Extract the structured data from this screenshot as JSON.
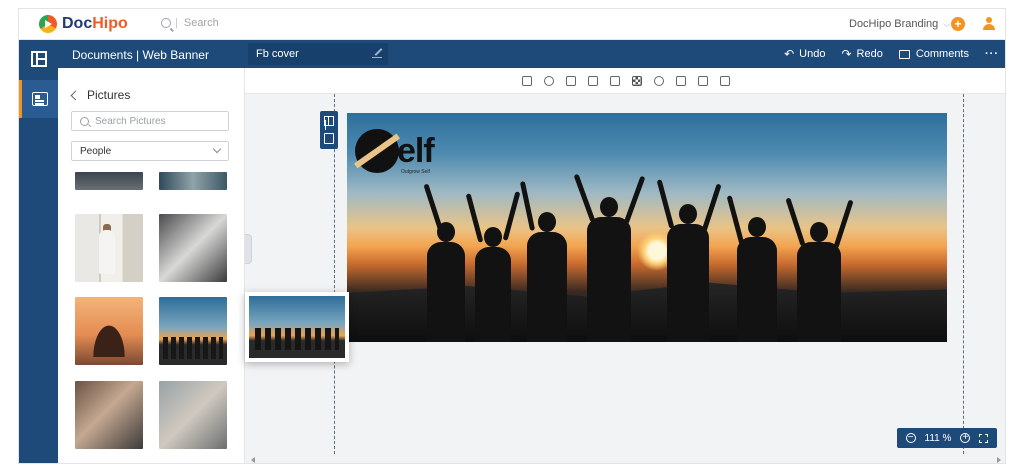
{
  "app": {
    "logo_prefix": "Doc",
    "logo_suffix": "Hipo"
  },
  "top": {
    "search_placeholder": "Search",
    "brand_menu": "DocHipo Branding"
  },
  "docbar": {
    "breadcrumb": "Documents | Web Banner",
    "doc_name": "Fb cover",
    "undo": "Undo",
    "redo": "Redo",
    "comments": "Comments"
  },
  "panel": {
    "title": "Pictures",
    "search_placeholder": "Search Pictures",
    "category": "People"
  },
  "canvas": {
    "logo_word": "elf",
    "logo_tag": "Outgrow Self"
  },
  "zoom": {
    "level": "111 %"
  },
  "colors": {
    "navy": "#1e4a7a",
    "accent": "#f39422"
  }
}
